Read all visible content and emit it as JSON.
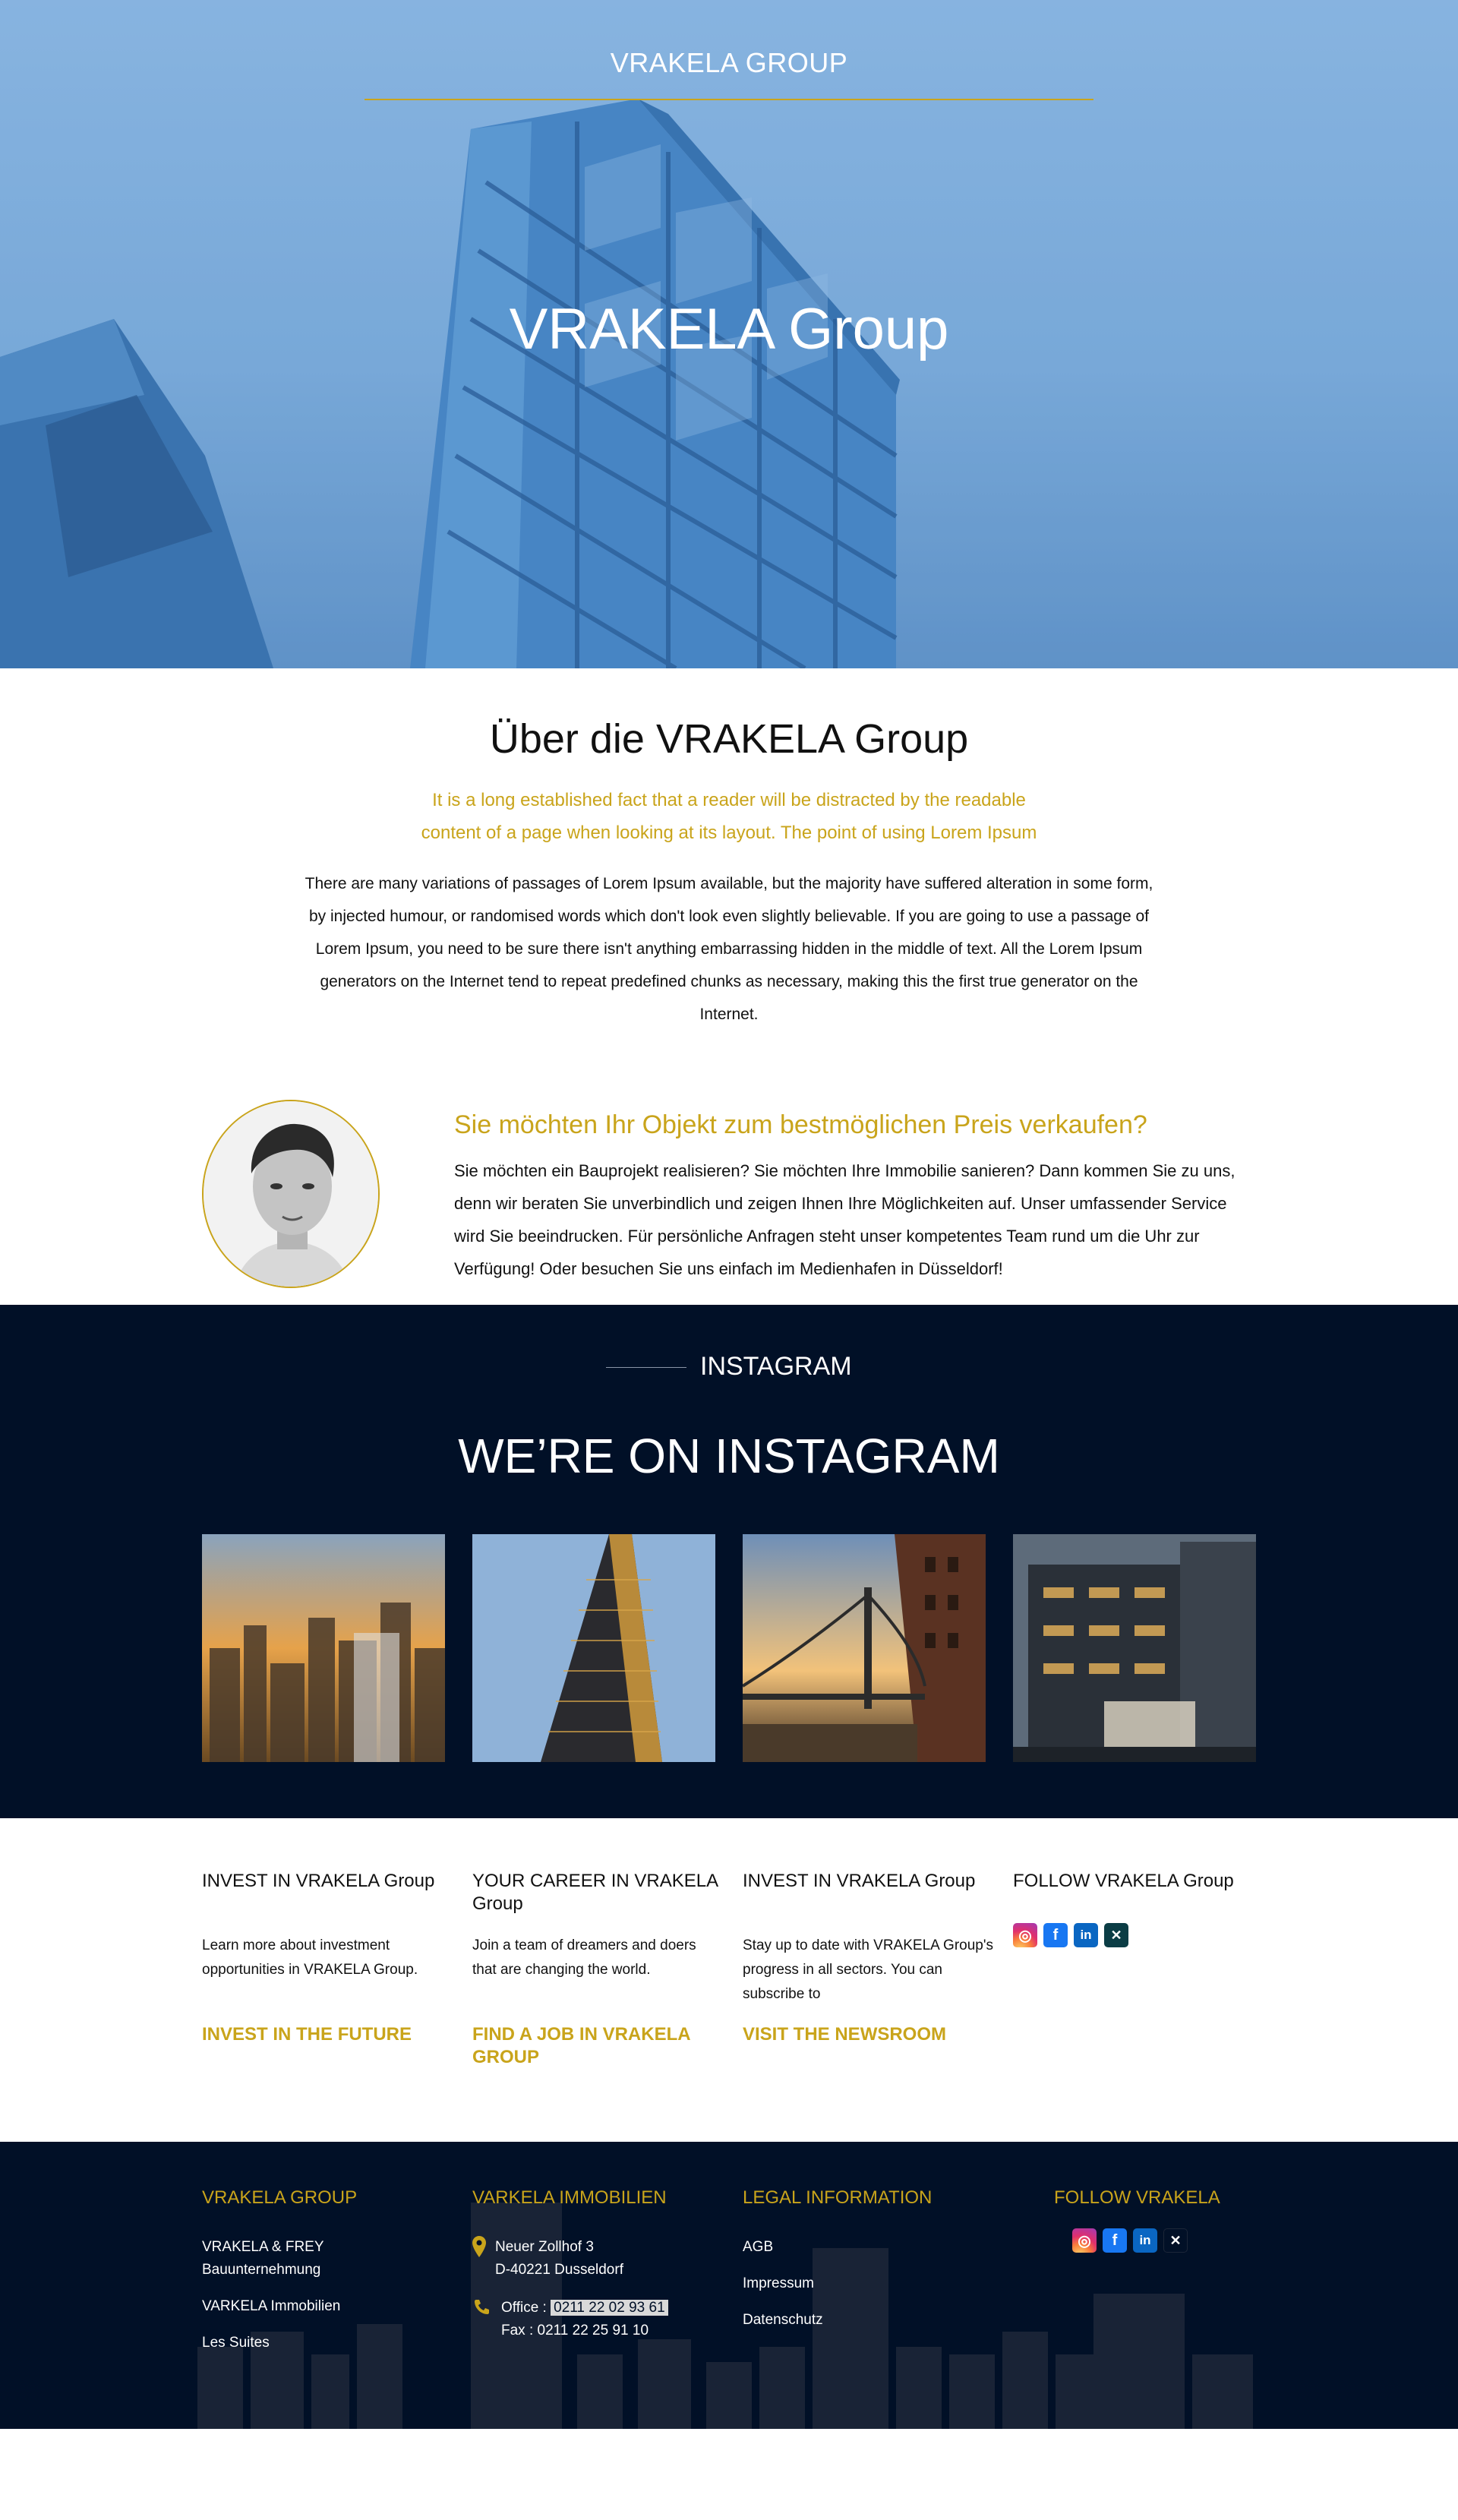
{
  "hero": {
    "brand": "VRAKELA GROUP",
    "title": "VRAKELA Group"
  },
  "about": {
    "heading": "Über die VRAKELA Group",
    "lead": "It is a long established fact that a reader will be distracted by the readable content of a page when looking at its layout. The point of using Lorem Ipsum",
    "body": "There are many variations of passages of Lorem Ipsum available, but the majority have suffered alteration in some form, by injected humour, or randomised words which don't look even slightly believable. If you are going to use a passage of Lorem Ipsum, you need to be sure there isn't anything embarrassing hidden in the middle of text. All the Lorem Ipsum generators on the Internet tend to repeat predefined chunks as necessary, making this the first true generator on the Internet."
  },
  "sell": {
    "heading": "Sie möchten Ihr Objekt zum bestmöglichen Preis verkaufen?",
    "body": "Sie möchten ein Bauprojekt realisieren? Sie möchten Ihre Immobilie sanieren? Dann kommen Sie zu uns, denn wir beraten Sie unverbindlich und zeigen Ihnen Ihre Möglichkeiten auf. Unser umfassender Service wird Sie beeindrucken. Für persönliche Anfragen steht unser kompetentes Team rund um die Uhr zur Verfügung! Oder besuchen Sie uns einfach im Medienhafen in Düsseldorf!"
  },
  "instagram": {
    "kicker": "INSTAGRAM",
    "heading": "WE’RE ON INSTAGRAM"
  },
  "columns": [
    {
      "title": "INVEST IN VRAKELA Group",
      "text": "Learn more about investment opportunities in VRAKELA Group.",
      "cta": "INVEST IN THE FUTURE"
    },
    {
      "title": "YOUR CAREER IN VRAKELA Group",
      "text": "Join a team of dreamers and doers that are changing the world.",
      "cta": "FIND A JOB IN VRAKELA GROUP"
    },
    {
      "title": "INVEST IN VRAKELA Group",
      "text": "Stay up to date with VRAKELA Group's progress in all sectors. You can subscribe to",
      "cta": "VISIT THE NEWSROOM"
    },
    {
      "title": "FOLLOW VRAKELA Group",
      "icons": [
        "instagram-icon",
        "facebook-icon",
        "linkedin-icon",
        "xing-icon"
      ]
    }
  ],
  "footer": {
    "group": {
      "title": "VRAKELA GROUP",
      "items": [
        "VRAKELA & FREY Bauunternehmung",
        "VARKELA Immobilien",
        "Les Suites"
      ]
    },
    "immobilien": {
      "title": "VARKELA IMMOBILIEN",
      "street": "Neuer Zollhof 3",
      "city": "D-40221 Dusseldorf",
      "office_label": "Office :",
      "office": "0211 22 02 93 61",
      "fax": "Fax : 0211 22 25 91 10"
    },
    "legal": {
      "title": "LEGAL INFORMATION",
      "items": [
        "AGB",
        "Impressum",
        "Datenschutz"
      ]
    },
    "follow": {
      "title": "FOLLOW VRAKELA"
    }
  },
  "colors": {
    "accent": "#c9a41b",
    "navy": "#011027",
    "hero_blue": "#7aaad8"
  }
}
